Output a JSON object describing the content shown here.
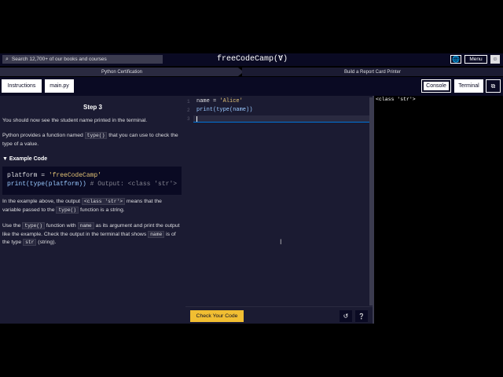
{
  "nav": {
    "search_placeholder": "Search 12,700+ of our books and courses",
    "logo": "freeCodeCamp(Ɐ)",
    "menu_label": "Menu",
    "lang_icon": "globe-icon",
    "avatar_icon": "user-icon"
  },
  "breadcrumb": {
    "course": "Python Certification",
    "project": "Build a Report Card Printer"
  },
  "toolbar": {
    "instructions": "Instructions",
    "file_tab": "main.py",
    "console": "Console",
    "terminal": "Terminal"
  },
  "instructions": {
    "step_title": "Step 3",
    "p1": "You should now see the student name printed in the terminal.",
    "p2_before": "Python provides a function named ",
    "p2_code": "type()",
    "p2_after": " that you can use to check the type of a value.",
    "example_title": "▼ Example Code",
    "example_line1_a": "platform = ",
    "example_line1_str": "'freeCodeCamp'",
    "example_line2_fn": "print(type(platform))",
    "example_line2_comment": " # Output: <class 'str'>",
    "p3_a": "In the example above, the output ",
    "p3_code1": "<class 'str'>",
    "p3_b": " means that the variable passed to the ",
    "p3_code2": "type()",
    "p3_c": " function is a string.",
    "p4_a": "Use the ",
    "p4_code1": "type()",
    "p4_b": " function with ",
    "p4_code2": "name",
    "p4_c": " as its argument and print the output like the example. Check the output in the terminal that shows ",
    "p4_code3": "name",
    "p4_d": " is of the type ",
    "p4_code4": "str",
    "p4_e": " (string)."
  },
  "editor": {
    "lines": [
      {
        "num": "1",
        "a": "name = ",
        "str": "'Alice'"
      },
      {
        "num": "2",
        "fn": "print(type(name))"
      },
      {
        "num": "3"
      }
    ]
  },
  "footer": {
    "check_label": "Check Your Code",
    "reset_icon": "reset-icon",
    "help_icon": "help-icon"
  },
  "terminal": {
    "output": "<class 'str'>"
  },
  "colors": {
    "accent": "#f1be32",
    "panel": "#1b1b32",
    "nav": "#0a0a23"
  }
}
